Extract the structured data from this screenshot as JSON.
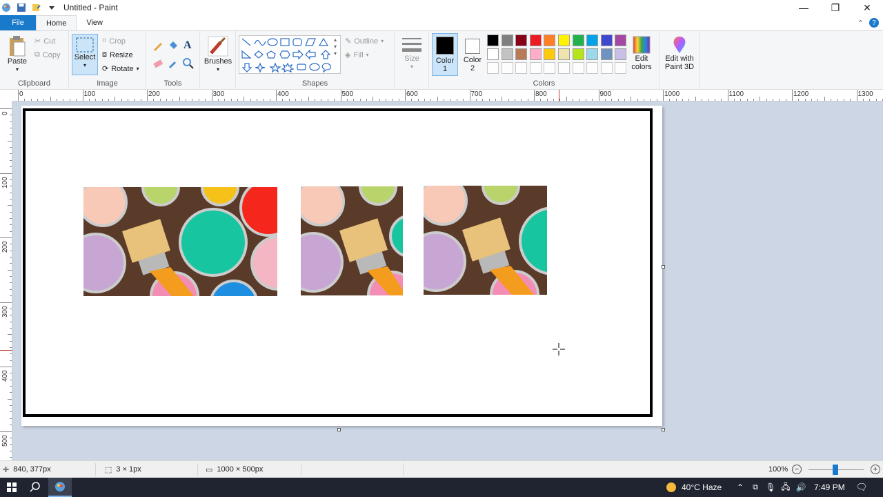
{
  "app": {
    "title": "Untitled - Paint"
  },
  "tabs": [
    {
      "label": "File"
    },
    {
      "label": "Home"
    },
    {
      "label": "View"
    }
  ],
  "ribbon": {
    "clipboard": {
      "group": "Clipboard",
      "paste": "Paste",
      "cut": "Cut",
      "copy": "Copy"
    },
    "image": {
      "group": "Image",
      "select": "Select",
      "crop": "Crop",
      "resize": "Resize",
      "rotate": "Rotate"
    },
    "tools": {
      "group": "Tools"
    },
    "brushes": {
      "label": "Brushes"
    },
    "shapes": {
      "group": "Shapes",
      "outline": "Outline",
      "fill": "Fill"
    },
    "size": {
      "label": "Size"
    },
    "colors": {
      "group": "Colors",
      "color1": "Color 1",
      "color2": "Color 2",
      "edit_colors": "Edit colors",
      "edit_paint3d": "Edit with Paint 3D",
      "color1_value": "#000000",
      "color2_value": "#ffffff",
      "palette_row1": [
        "#000000",
        "#7f7f7f",
        "#880015",
        "#ed1c24",
        "#ff7f27",
        "#fff200",
        "#22b14c",
        "#00a2e8",
        "#3f48cc",
        "#a349a4"
      ],
      "palette_row2": [
        "#ffffff",
        "#c3c3c3",
        "#b97a57",
        "#ffaec9",
        "#ffc90e",
        "#efe4b0",
        "#b5e61d",
        "#99d9ea",
        "#7092be",
        "#c8bfe7"
      ]
    }
  },
  "ruler": {
    "h": [
      "0",
      "100",
      "200",
      "300",
      "400",
      "500",
      "600",
      "700",
      "800",
      "900",
      "1000",
      "1100",
      "1200",
      "1300"
    ],
    "v": [
      "0",
      "100",
      "200",
      "300",
      "400",
      "500"
    ]
  },
  "status": {
    "cursor": "840, 377px",
    "selection": "3 × 1px",
    "image_size": "1000 × 500px",
    "zoom": "100%"
  },
  "taskbar": {
    "weather": "40°C  Haze",
    "time": "7:49 PM"
  }
}
